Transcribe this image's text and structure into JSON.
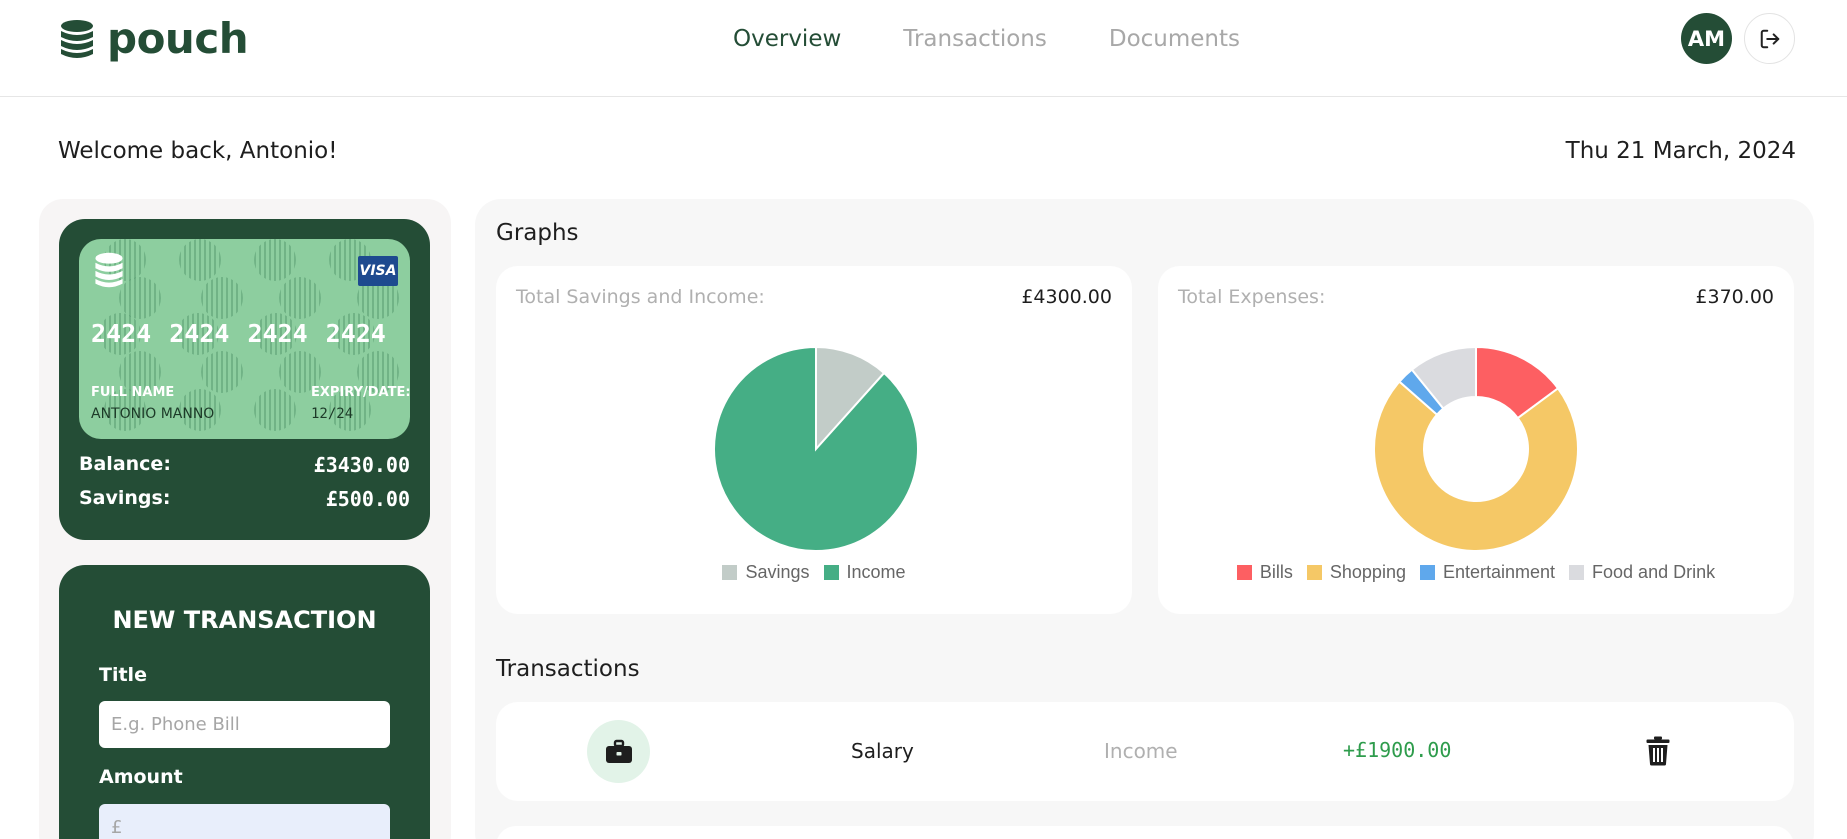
{
  "app": {
    "name": "pouch"
  },
  "nav": {
    "items": [
      "Overview",
      "Transactions",
      "Documents"
    ],
    "active": "Overview"
  },
  "user": {
    "initials": "AM"
  },
  "welcome": {
    "message": "Welcome back, Antonio!",
    "date": "Thu 21 March, 2024"
  },
  "card": {
    "brand": "VISA",
    "number": [
      "2424",
      "2424",
      "2424",
      "2424"
    ],
    "name_label": "FULL NAME",
    "name": "ANTONIO MANNO",
    "expiry_label": "EXPIRY/DATE:",
    "expiry": "12/24",
    "balance_label": "Balance:",
    "balance": "£3430.00",
    "savings_label": "Savings:",
    "savings": "£500.00"
  },
  "new_transaction": {
    "title": "NEW TRANSACTION",
    "title_label": "Title",
    "title_placeholder": "E.g. Phone Bill",
    "amount_label": "Amount",
    "amount_placeholder": "£"
  },
  "graphs": {
    "section_title": "Graphs",
    "savings_income": {
      "label": "Total Savings and Income:",
      "total": "£4300.00"
    },
    "expenses": {
      "label": "Total Expenses:",
      "total": "£370.00"
    }
  },
  "transactions": {
    "section_title": "Transactions",
    "rows": [
      {
        "icon": "briefcase-icon",
        "name": "Salary",
        "category": "Income",
        "amount": "+£1900.00"
      }
    ]
  },
  "colors": {
    "brand_dark": "#244d36",
    "savings": "#c2ccc8",
    "income": "#45ae85",
    "bills": "#fd5f62",
    "shopping": "#f5c866",
    "entertainment": "#5fa8ec",
    "food": "#dadbdf",
    "positive_amount": "#2e9c4c"
  },
  "chart_data": [
    {
      "type": "pie",
      "labels": [
        "Savings",
        "Income"
      ],
      "values": [
        500,
        3800
      ],
      "colors": [
        "#c2ccc8",
        "#45ae85"
      ],
      "legend": "bottom"
    },
    {
      "type": "pie",
      "variant": "doughnut",
      "labels": [
        "Bills",
        "Shopping",
        "Entertainment",
        "Food and Drink"
      ],
      "values": [
        55,
        265,
        10,
        40
      ],
      "colors": [
        "#fd5f62",
        "#f5c866",
        "#5fa8ec",
        "#dadbdf"
      ],
      "legend": "bottom"
    }
  ]
}
